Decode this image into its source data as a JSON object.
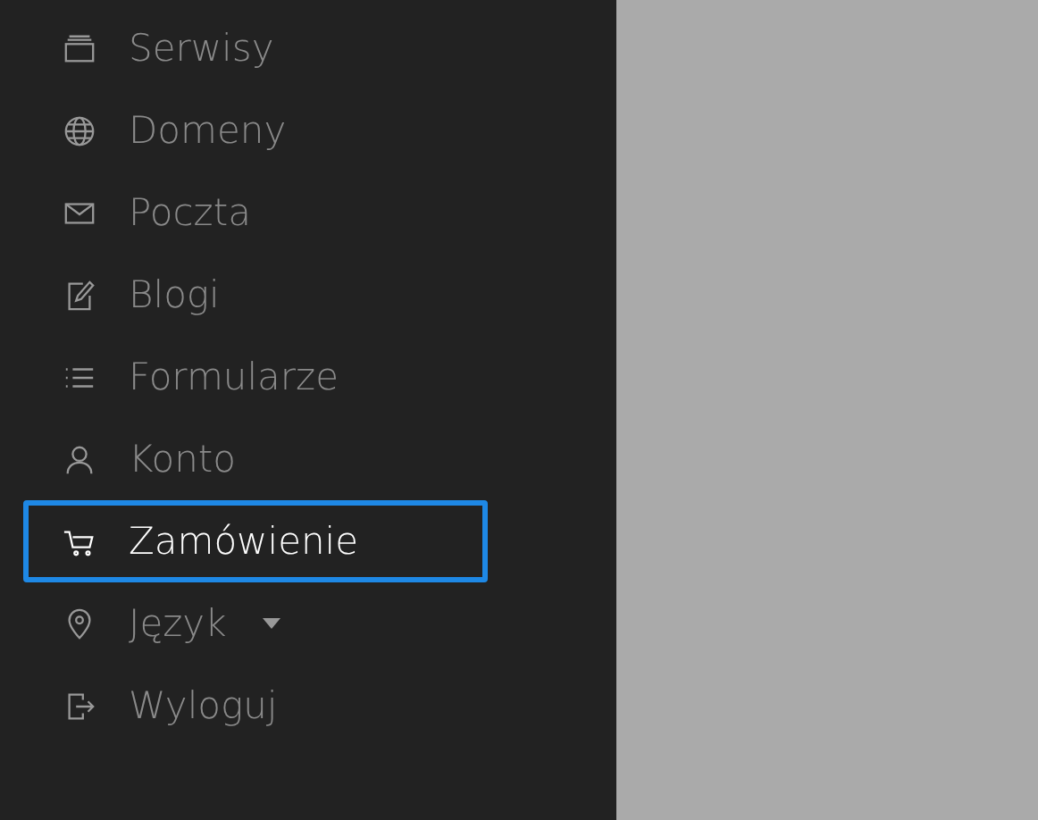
{
  "sidebar": {
    "items": [
      {
        "label": "Serwisy",
        "selected": false
      },
      {
        "label": "Domeny",
        "selected": false
      },
      {
        "label": "Poczta",
        "selected": false
      },
      {
        "label": "Blogi",
        "selected": false
      },
      {
        "label": "Formularze",
        "selected": false
      },
      {
        "label": "Konto",
        "selected": false
      },
      {
        "label": "Zamówienie",
        "selected": true
      },
      {
        "label": "Język",
        "selected": false,
        "dropdown": true
      },
      {
        "label": "Wyloguj",
        "selected": false
      }
    ]
  }
}
